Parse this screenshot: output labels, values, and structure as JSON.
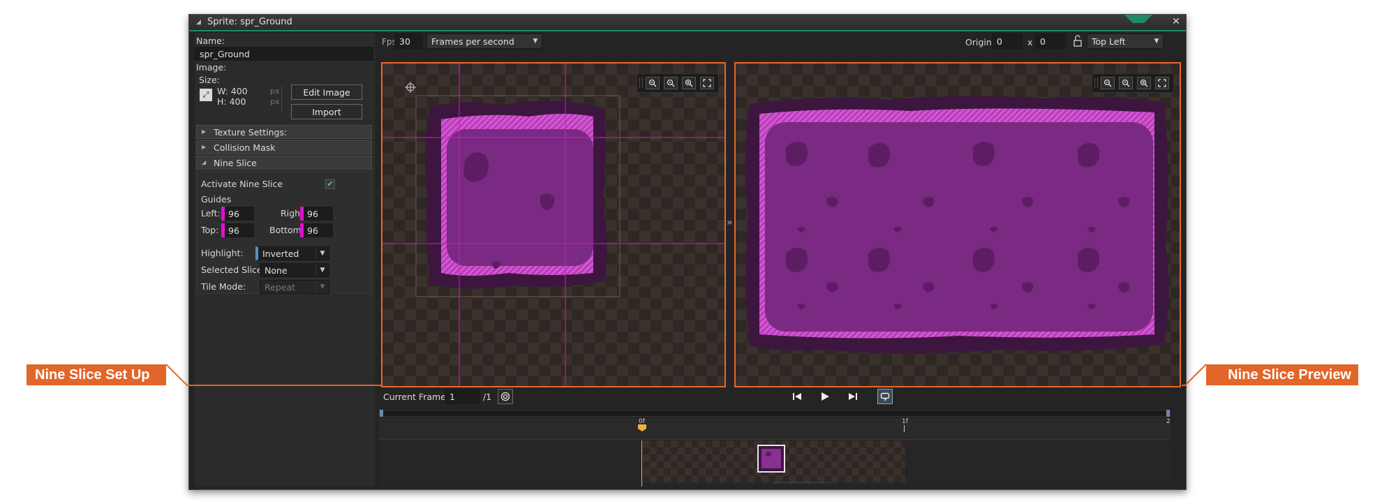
{
  "window": {
    "title": "Sprite: spr_Ground",
    "close": "✕"
  },
  "left": {
    "name_label": "Name:",
    "name_value": "spr_Ground",
    "image_label": "Image:",
    "size_label": "Size:",
    "width_text": "W: 400",
    "height_text": "H: 400",
    "unit": "px",
    "edit_image": "Edit Image",
    "import": "Import",
    "sections": {
      "texture": "Texture Settings:",
      "collision": "Collision Mask",
      "nine_slice": "Nine Slice"
    },
    "activate_label": "Activate Nine Slice",
    "activate_checked": true,
    "guides_label": "Guides",
    "left_label": "Left:",
    "left_value": "96",
    "right_label": "Right:",
    "right_value": "96",
    "top_label": "Top:",
    "top_value": "96",
    "bottom_label": "Bottom:",
    "bottom_value": "96",
    "highlight_label": "Highlight:",
    "highlight_value": "Inverted",
    "selected_slice_label": "Selected Slice:",
    "selected_slice_value": "None",
    "tile_mode_label": "Tile Mode:",
    "tile_mode_value": "Repeat"
  },
  "toolbar": {
    "fps_label": "Fps",
    "fps_value": "30",
    "fps_mode": "Frames per second",
    "origin_label": "Origin",
    "origin_x": "0",
    "x_sep": "x",
    "origin_y": "0",
    "origin_preset": "Top Left"
  },
  "callouts": {
    "setup": "Nine Slice Set Up",
    "preview": "Nine Slice Preview"
  },
  "playback": {
    "current_frame_label": "Current Frame:",
    "current_frame_value": "1",
    "total_frames": "/1"
  },
  "timeline": {
    "tick_start": "0f",
    "tick_mid": "1f",
    "tick_end": "2"
  },
  "colors": {
    "accent": "#e8692a",
    "guide": "#e010d0",
    "title_bar_accent": "#1f8a6a"
  }
}
